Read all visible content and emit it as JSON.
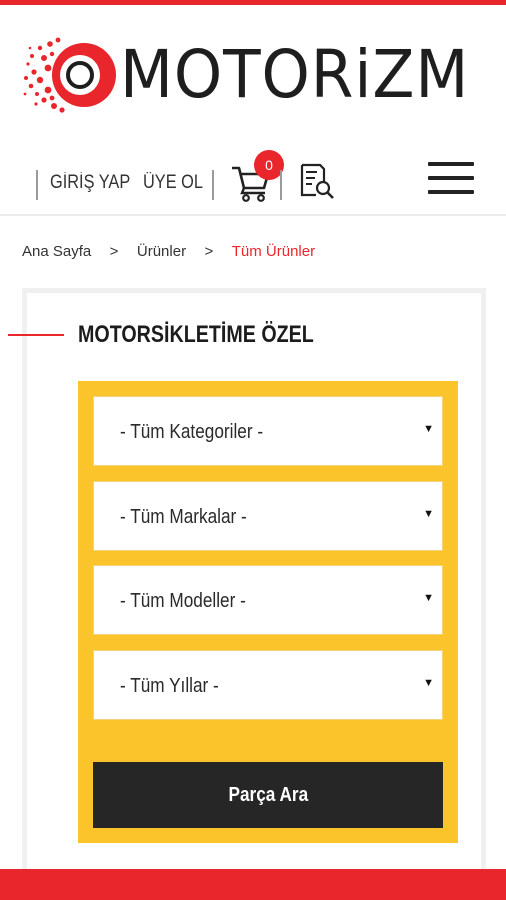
{
  "colors": {
    "accent": "#e8262b",
    "yellow": "#fbc42a",
    "dark": "#262626"
  },
  "logo": {
    "wordmark": "MOTORiZM"
  },
  "nav": {
    "login": "GİRİŞ YAP",
    "register": "ÜYE OL",
    "cart_count": "0",
    "icons": [
      "cart-icon",
      "order-search-icon",
      "hamburger-menu-icon"
    ]
  },
  "breadcrumb": [
    {
      "label": "Ana Sayfa"
    },
    {
      "label": "Ürünler"
    },
    {
      "label": "Tüm Ürünler"
    }
  ],
  "filter": {
    "title": "MOTORSİKLETİME ÖZEL",
    "selects": [
      {
        "value": "- Tüm Kategoriler -"
      },
      {
        "value": "- Tüm Markalar -"
      },
      {
        "value": "- Tüm Modeller -"
      },
      {
        "value": "- Tüm Yıllar -"
      }
    ],
    "submit_label": "Parça Ara"
  }
}
